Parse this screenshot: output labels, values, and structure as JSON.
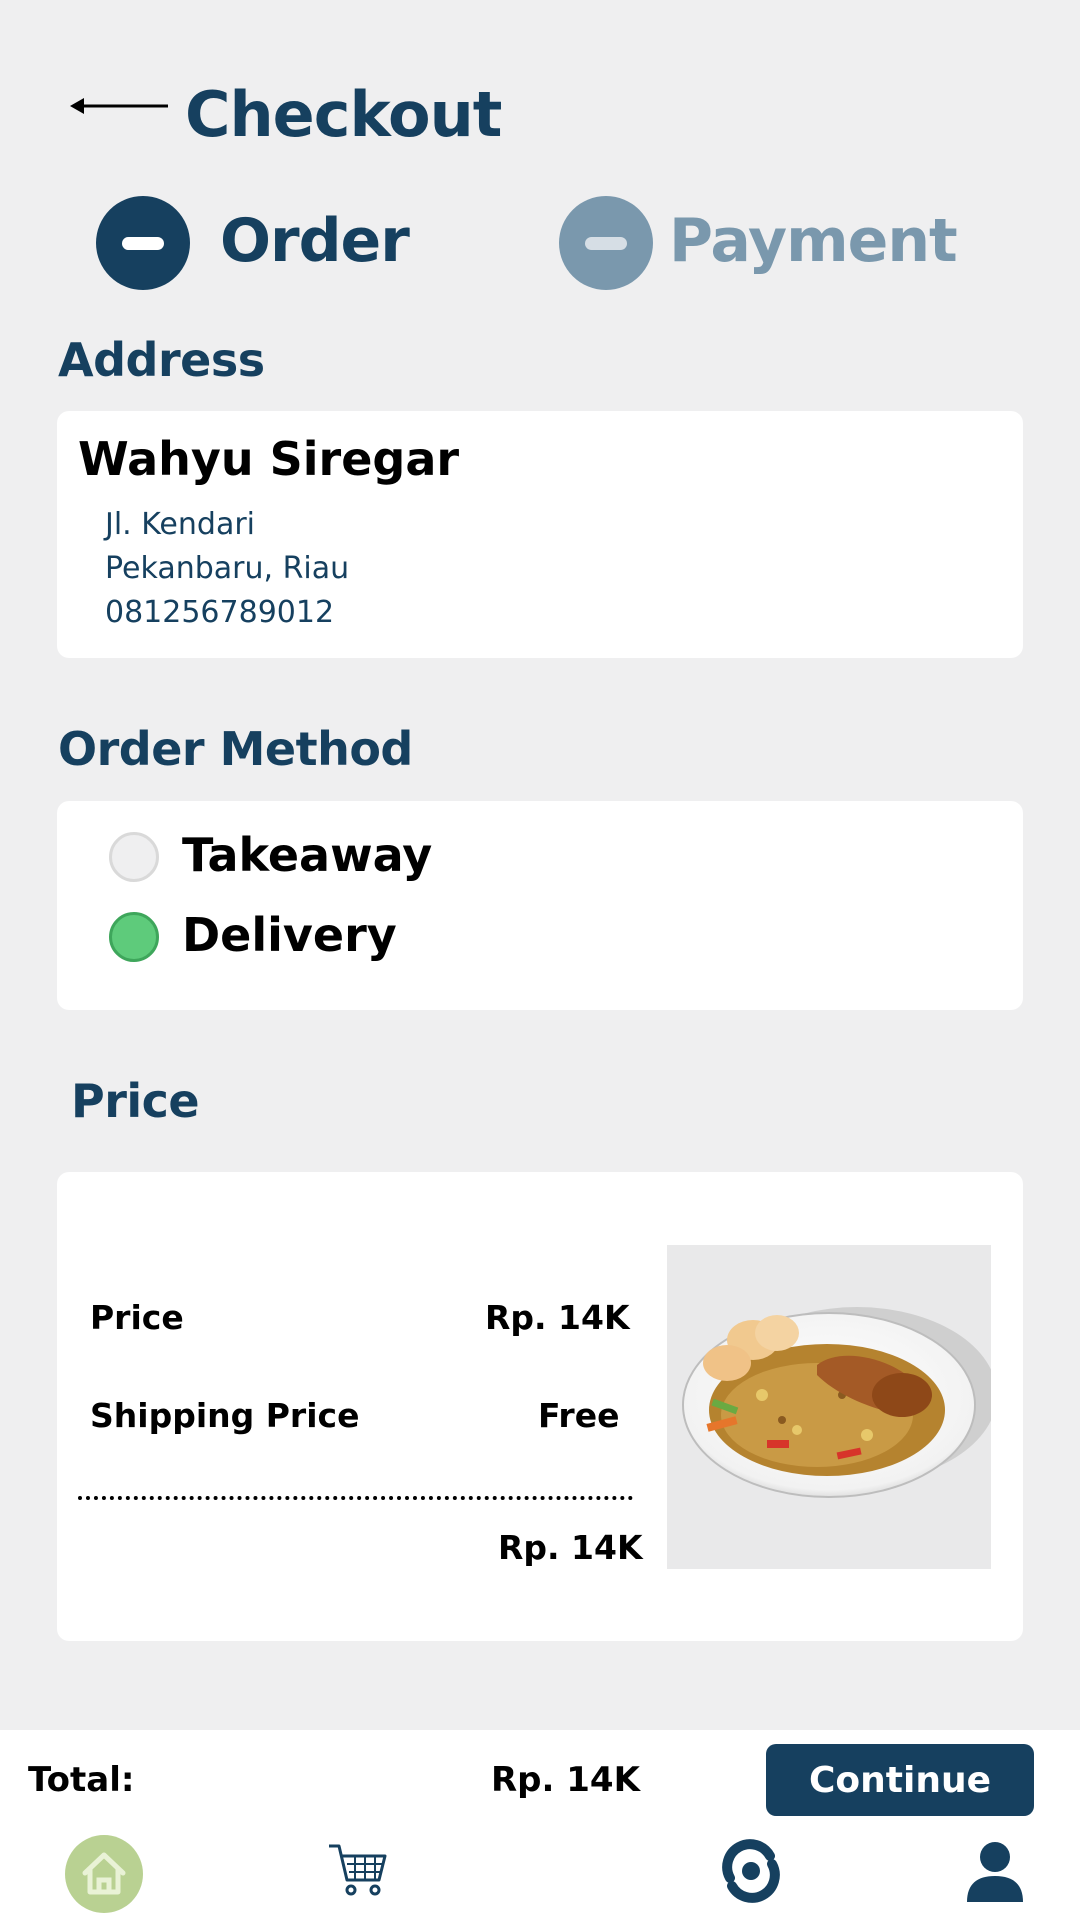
{
  "header": {
    "title": "Checkout",
    "back_icon": "arrow-left-icon"
  },
  "steps": [
    {
      "label": "Order",
      "active": true,
      "color": "#16405f"
    },
    {
      "label": "Payment",
      "active": false,
      "color": "#7a98ad"
    }
  ],
  "address": {
    "heading": "Address",
    "name": "Wahyu Siregar",
    "street": "Jl. Kendari",
    "city": "Pekanbaru, Riau",
    "phone": "081256789012"
  },
  "order_method": {
    "heading": "Order Method",
    "options": [
      {
        "label": "Takeaway",
        "selected": false
      },
      {
        "label": "Delivery",
        "selected": true
      }
    ],
    "selected_color": "#5ecb7b"
  },
  "price": {
    "heading": "Price",
    "rows": [
      {
        "label": "Price",
        "value": "Rp. 14K"
      },
      {
        "label": "Shipping Price",
        "value": "Free"
      }
    ],
    "total": "Rp. 14K",
    "image": "fried-rice-with-chicken"
  },
  "footer": {
    "total_label": "Total:",
    "total_value": "Rp. 14K",
    "continue_label": "Continue",
    "nav": [
      "home-icon",
      "cart-icon",
      "orders-icon",
      "profile-icon"
    ],
    "active_nav_color": "#b9d192"
  },
  "colors": {
    "primary": "#16405f",
    "background": "#efeff0"
  }
}
